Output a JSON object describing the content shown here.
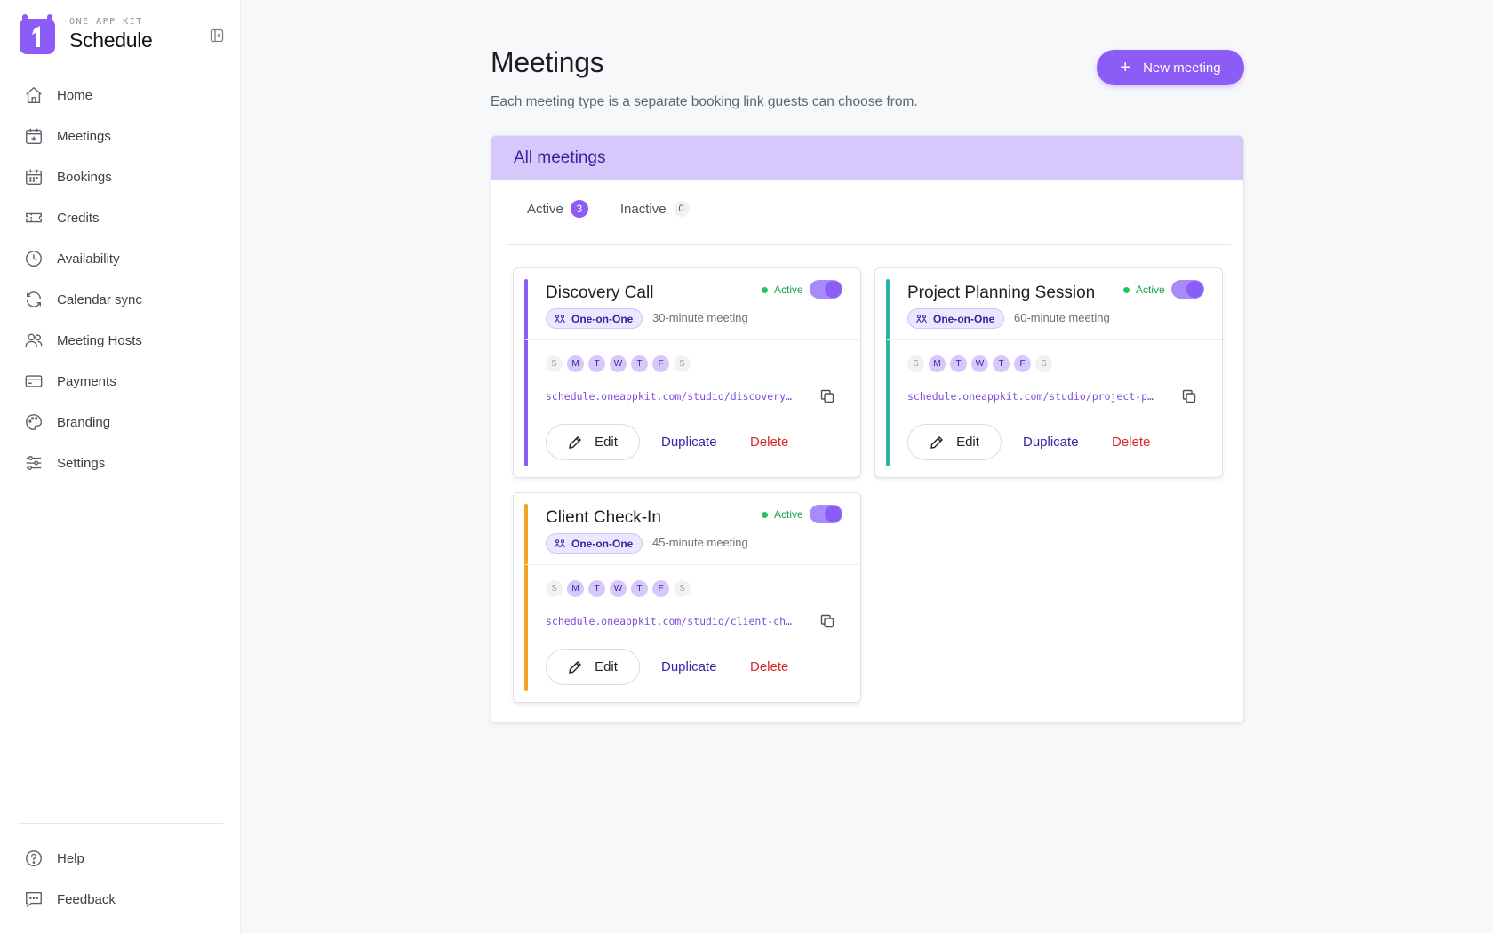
{
  "app": {
    "kit_label": "ONE APP KIT",
    "name": "Schedule"
  },
  "sidebar": {
    "items": [
      {
        "label": "Home",
        "icon": "home-icon"
      },
      {
        "label": "Meetings",
        "icon": "calendar-plus-icon"
      },
      {
        "label": "Bookings",
        "icon": "calendar-icon"
      },
      {
        "label": "Credits",
        "icon": "ticket-icon"
      },
      {
        "label": "Availability",
        "icon": "clock-icon"
      },
      {
        "label": "Calendar sync",
        "icon": "refresh-icon"
      },
      {
        "label": "Meeting Hosts",
        "icon": "users-icon"
      },
      {
        "label": "Payments",
        "icon": "credit-card-icon"
      },
      {
        "label": "Branding",
        "icon": "palette-icon"
      },
      {
        "label": "Settings",
        "icon": "sliders-icon"
      }
    ],
    "bottom_items": [
      {
        "label": "Help",
        "icon": "help-circle-icon"
      },
      {
        "label": "Feedback",
        "icon": "message-icon"
      }
    ]
  },
  "main": {
    "title": "Meetings",
    "subtitle": "Each meeting type is a separate booking link guests can choose from.",
    "new_button_label": "New meeting",
    "panel_title": "All meetings",
    "tabs": [
      {
        "label": "Active",
        "count": "3",
        "selected": true
      },
      {
        "label": "Inactive",
        "count": "0",
        "selected": false
      }
    ]
  },
  "meetings": [
    {
      "title": "Discovery Call",
      "status": "Active",
      "type": "One-on-One",
      "duration": "30-minute meeting",
      "accent_color": "#8b5cf6",
      "days": [
        "S",
        "M",
        "T",
        "W",
        "T",
        "F",
        "S"
      ],
      "days_active": [
        false,
        true,
        true,
        true,
        true,
        true,
        false
      ],
      "link": "schedule.oneappkit.com/studio/discovery…",
      "edit_label": "Edit",
      "duplicate_label": "Duplicate",
      "delete_label": "Delete"
    },
    {
      "title": "Project Planning Session",
      "status": "Active",
      "type": "One-on-One",
      "duration": "60-minute meeting",
      "accent_color": "#2bb5a6",
      "days": [
        "S",
        "M",
        "T",
        "W",
        "T",
        "F",
        "S"
      ],
      "days_active": [
        false,
        true,
        true,
        true,
        true,
        true,
        false
      ],
      "link": "schedule.oneappkit.com/studio/project-p…",
      "edit_label": "Edit",
      "duplicate_label": "Duplicate",
      "delete_label": "Delete"
    },
    {
      "title": "Client Check-In",
      "status": "Active",
      "type": "One-on-One",
      "duration": "45-minute meeting",
      "accent_color": "#f5a524",
      "days": [
        "S",
        "M",
        "T",
        "W",
        "T",
        "F",
        "S"
      ],
      "days_active": [
        false,
        true,
        true,
        true,
        true,
        true,
        false
      ],
      "link": "schedule.oneappkit.com/studio/client-ch…",
      "edit_label": "Edit",
      "duplicate_label": "Duplicate",
      "delete_label": "Delete"
    }
  ],
  "colors": {
    "accent": "#8b5cf6",
    "panel_header": "#d6c8fb",
    "active_status": "#16a34a",
    "delete": "#dc2626"
  }
}
